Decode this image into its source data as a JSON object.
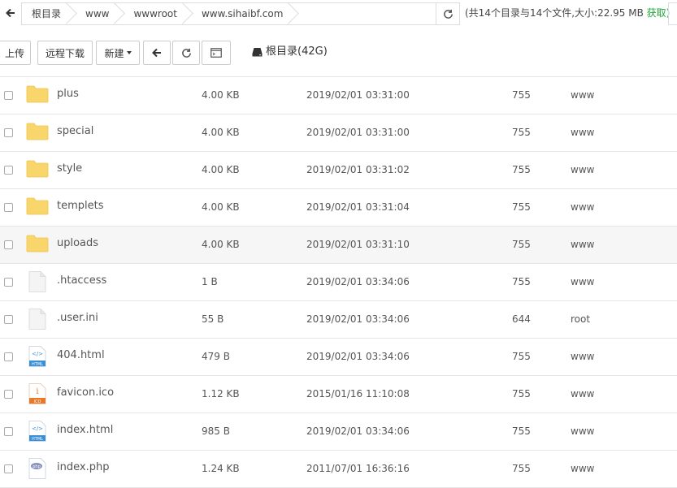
{
  "pathbar": {
    "crumbs": [
      "根目录",
      "www",
      "wwwroot",
      "www.sihaibf.com"
    ],
    "summary": "(共14个目录与14个文件,大小:22.95 MB",
    "get_label": "获取)"
  },
  "toolbar": {
    "upload": "上传",
    "remote_download": "远程下载",
    "new": "新建",
    "root_label": "根目录(42G)"
  },
  "files": [
    {
      "name": "plus",
      "type": "folder",
      "size": "4.00 KB",
      "time": "2019/02/01 03:31:00",
      "perm": "755",
      "owner": "www"
    },
    {
      "name": "special",
      "type": "folder",
      "size": "4.00 KB",
      "time": "2019/02/01 03:31:00",
      "perm": "755",
      "owner": "www"
    },
    {
      "name": "style",
      "type": "folder",
      "size": "4.00 KB",
      "time": "2019/02/01 03:31:02",
      "perm": "755",
      "owner": "www"
    },
    {
      "name": "templets",
      "type": "folder",
      "size": "4.00 KB",
      "time": "2019/02/01 03:31:04",
      "perm": "755",
      "owner": "www"
    },
    {
      "name": "uploads",
      "type": "folder",
      "size": "4.00 KB",
      "time": "2019/02/01 03:31:10",
      "perm": "755",
      "owner": "www"
    },
    {
      "name": ".htaccess",
      "type": "blank",
      "size": "1 B",
      "time": "2019/02/01 03:34:06",
      "perm": "755",
      "owner": "www"
    },
    {
      "name": ".user.ini",
      "type": "blank",
      "size": "55 B",
      "time": "2019/02/01 03:34:06",
      "perm": "644",
      "owner": "root"
    },
    {
      "name": "404.html",
      "type": "html",
      "size": "479 B",
      "time": "2019/02/01 03:34:06",
      "perm": "755",
      "owner": "www"
    },
    {
      "name": "favicon.ico",
      "type": "ico",
      "size": "1.12 KB",
      "time": "2015/01/16 11:10:08",
      "perm": "755",
      "owner": "www"
    },
    {
      "name": "index.html",
      "type": "html",
      "size": "985 B",
      "time": "2019/02/01 03:34:06",
      "perm": "755",
      "owner": "www"
    },
    {
      "name": "index.php",
      "type": "php",
      "size": "1.24 KB",
      "time": "2011/07/01 16:36:16",
      "perm": "755",
      "owner": "www"
    }
  ],
  "icons": {
    "back": "arrow-left-icon",
    "refresh": "refresh-icon",
    "terminal": "terminal-icon",
    "disk": "hard-drive-icon"
  },
  "colors": {
    "get_link": "#20a53a",
    "folder": "#f9d66b",
    "html_icon": "#3a8fd6",
    "ico_icon": "#e8782a"
  }
}
